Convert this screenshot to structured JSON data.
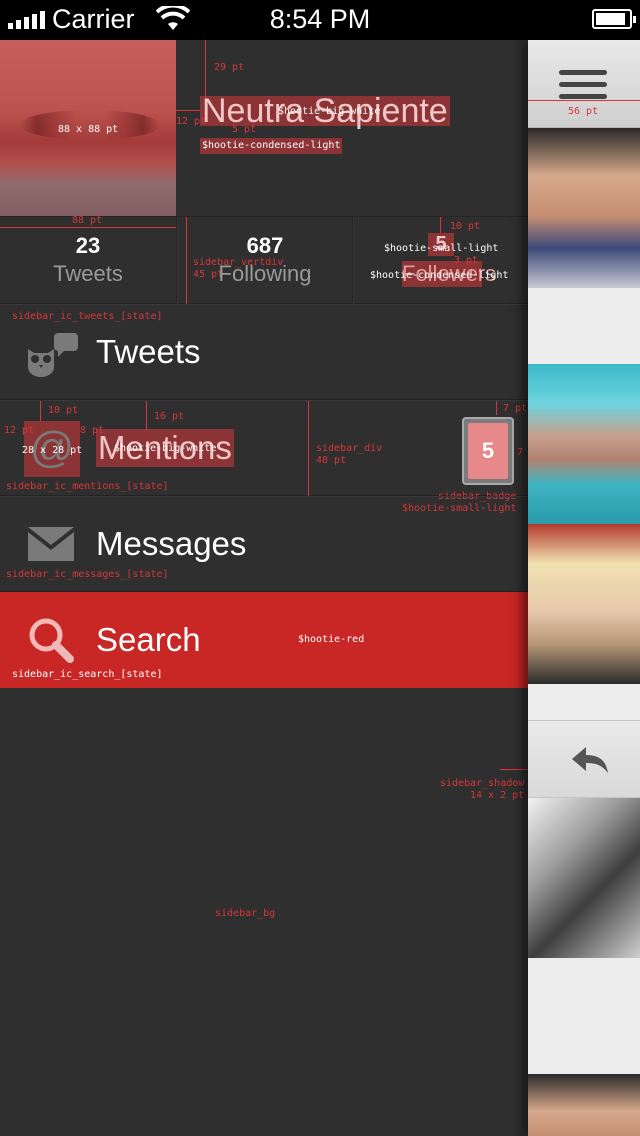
{
  "status_bar": {
    "carrier": "Carrier",
    "time": "8:54 PM",
    "battery_level": 0.9
  },
  "profile": {
    "name": "Neutra Sapiente",
    "handle": "$hootie-condensed-light",
    "avatar_icon": "profile-photo"
  },
  "stats": {
    "tweets": {
      "value": "23",
      "label": "Tweets"
    },
    "following": {
      "value": "687",
      "label": "Following"
    },
    "followers": {
      "value": "5",
      "label": "Followers"
    }
  },
  "menu": {
    "tweets": {
      "label": "Tweets",
      "icon": "owl-speech-icon"
    },
    "mentions": {
      "label": "Mentions",
      "icon": "at-icon",
      "badge": "5"
    },
    "messages": {
      "label": "Messages",
      "icon": "envelope-icon"
    },
    "search": {
      "label": "Search",
      "icon": "search-icon"
    }
  },
  "annotations": {
    "a29": "29 pt",
    "a12top": "12 pt",
    "a5": "5 pt",
    "big_white_1": "$hootie-big-white",
    "avatar_size": "88 x 88 pt",
    "a88": "88 pt",
    "vertdiv": "sidebar_vertdiv",
    "vertdiv_size": "45 pt",
    "a10": "10 pt",
    "small_light": "$hootie-small-light",
    "a3": "3 pt",
    "condensed_light": "$hootie-condensed-light",
    "ic_tweets": "sidebar_ic_tweets_[state]",
    "a10b": "10 pt",
    "a16": "16 pt",
    "a12": "12 pt",
    "a8": "8 pt",
    "icon_size": "28 x 28 pt",
    "big_white_2": "$hootie-big-white",
    "div_name": "sidebar_div",
    "div_size": "48 pt",
    "a7a": "7 pt",
    "a7b": "7 pt",
    "badge_name": "sidebar_badge",
    "badge_font": "$hootie-small-light",
    "ic_mentions": "sidebar_ic_mentions_[state]",
    "ic_messages": "sidebar_ic_messages_[state]",
    "red": "$hootie-red",
    "ic_search": "sidebar_ic_search_[state]",
    "shadow": "sidebar_shadow",
    "shadow_size": "14 x 2 pt",
    "bg": "sidebar_bg",
    "a56": "56 pt"
  },
  "colors": {
    "accent": "#c92725",
    "sidebar_bg": "#2f2f2f",
    "redline": "#d7363a"
  }
}
